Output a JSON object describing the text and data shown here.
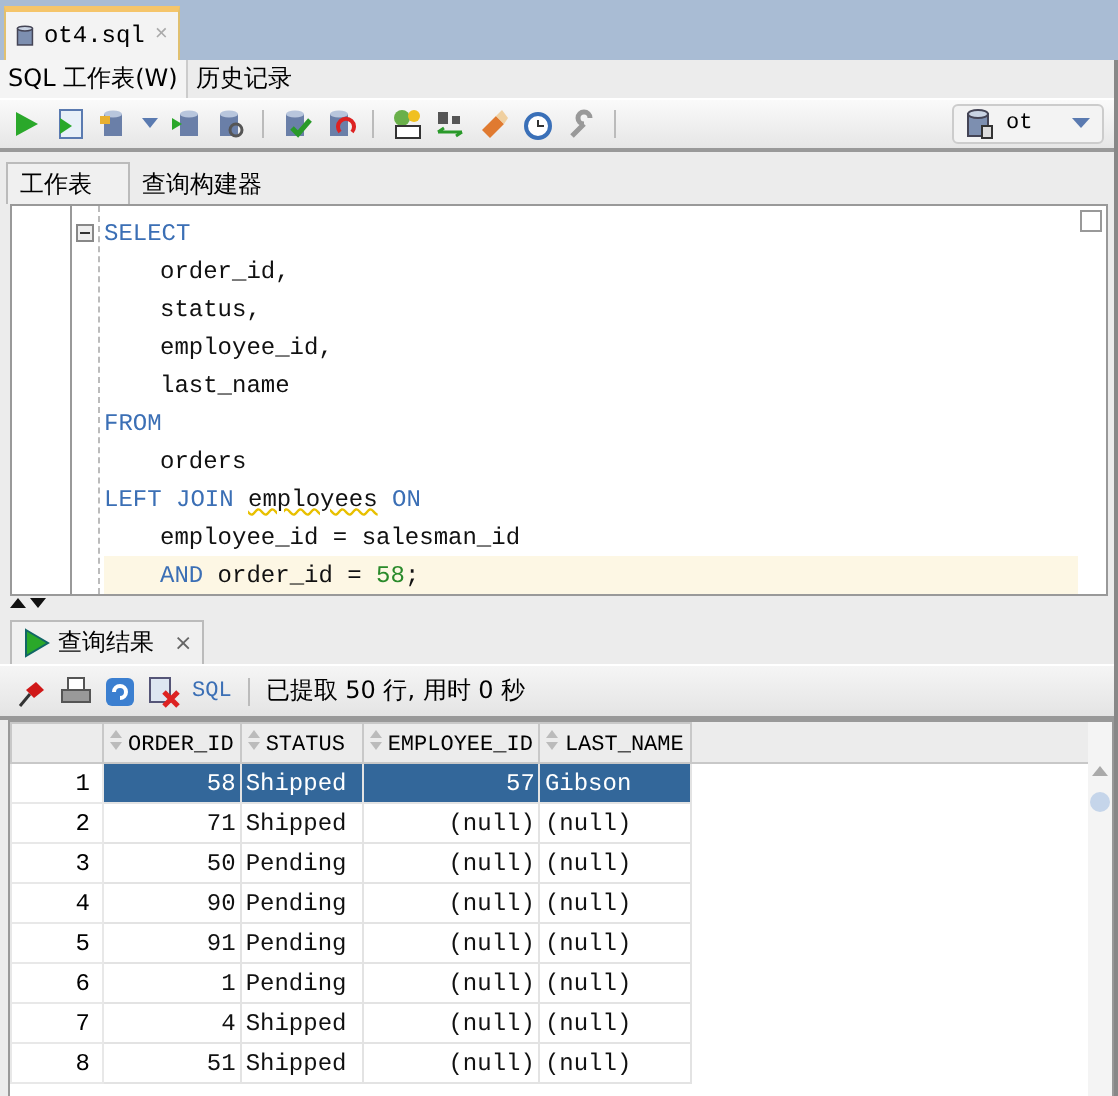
{
  "file_tab": {
    "label": "ot4.sql",
    "close": "×"
  },
  "sub_tabs": [
    {
      "label": "SQL 工作表(W)",
      "selected": true
    },
    {
      "label": "历史记录",
      "selected": false
    }
  ],
  "connection": {
    "label": "ot"
  },
  "worksheet_tabs": [
    {
      "label": "工作表",
      "selected": true
    },
    {
      "label": "查询构建器",
      "selected": false
    }
  ],
  "code_lines": [
    {
      "indented": false,
      "current": false,
      "tokens": [
        {
          "kind": "keyword",
          "text": "SELECT"
        }
      ]
    },
    {
      "indented": true,
      "current": false,
      "tokens": [
        {
          "kind": "plain",
          "text": "order_id,"
        }
      ]
    },
    {
      "indented": true,
      "current": false,
      "tokens": [
        {
          "kind": "plain",
          "text": "status,"
        }
      ]
    },
    {
      "indented": true,
      "current": false,
      "tokens": [
        {
          "kind": "plain",
          "text": "employee_id,"
        }
      ]
    },
    {
      "indented": true,
      "current": false,
      "tokens": [
        {
          "kind": "plain",
          "text": "last_name"
        }
      ]
    },
    {
      "indented": false,
      "current": false,
      "tokens": [
        {
          "kind": "keyword",
          "text": "FROM"
        }
      ]
    },
    {
      "indented": true,
      "current": false,
      "tokens": [
        {
          "kind": "plain",
          "text": "orders"
        }
      ]
    },
    {
      "indented": false,
      "current": false,
      "tokens": [
        {
          "kind": "keyword",
          "text": "LEFT JOIN "
        },
        {
          "kind": "flagged",
          "text": "employees"
        },
        {
          "kind": "keyword",
          "text": " ON"
        }
      ]
    },
    {
      "indented": true,
      "current": false,
      "tokens": [
        {
          "kind": "plain",
          "text": "employee_id = salesman_id"
        }
      ]
    },
    {
      "indented": true,
      "current": true,
      "tokens": [
        {
          "kind": "keyword",
          "text": "AND"
        },
        {
          "kind": "plain",
          "text": " order_id = "
        },
        {
          "kind": "number",
          "text": "58"
        },
        {
          "kind": "plain",
          "text": ";"
        }
      ]
    }
  ],
  "results_tab": {
    "label": "查询结果",
    "close": "×"
  },
  "results_toolbar": {
    "sql_label": "SQL",
    "status": "已提取 50 行, 用时 0 秒"
  },
  "table": {
    "columns": [
      "ORDER_ID",
      "STATUS",
      "EMPLOYEE_ID",
      "LAST_NAME"
    ],
    "rows": [
      {
        "number": "1",
        "selected": true,
        "cells": [
          "58",
          "Shipped",
          "57",
          "Gibson"
        ]
      },
      {
        "number": "2",
        "selected": false,
        "cells": [
          "71",
          "Shipped",
          "(null)",
          "(null)"
        ]
      },
      {
        "number": "3",
        "selected": false,
        "cells": [
          "50",
          "Pending",
          "(null)",
          "(null)"
        ]
      },
      {
        "number": "4",
        "selected": false,
        "cells": [
          "90",
          "Pending",
          "(null)",
          "(null)"
        ]
      },
      {
        "number": "5",
        "selected": false,
        "cells": [
          "91",
          "Pending",
          "(null)",
          "(null)"
        ]
      },
      {
        "number": "6",
        "selected": false,
        "cells": [
          "1",
          "Pending",
          "(null)",
          "(null)"
        ]
      },
      {
        "number": "7",
        "selected": false,
        "cells": [
          "4",
          "Shipped",
          "(null)",
          "(null)"
        ]
      },
      {
        "number": "8",
        "selected": false,
        "cells": [
          "51",
          "Shipped",
          "(null)",
          "(null)"
        ]
      }
    ]
  }
}
